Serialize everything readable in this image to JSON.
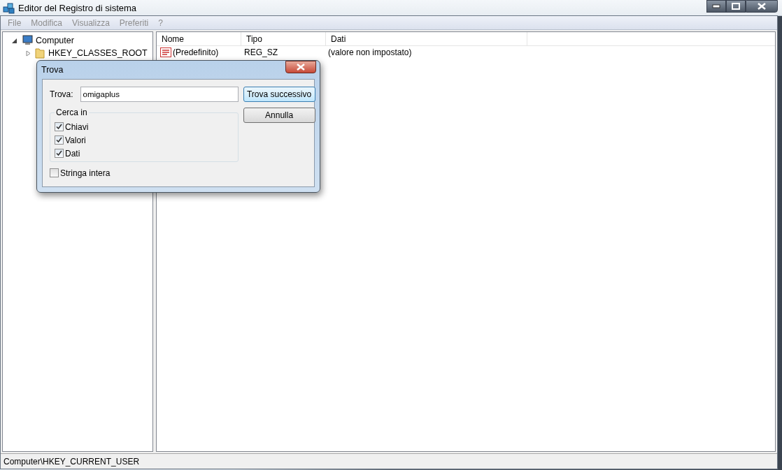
{
  "window": {
    "title": "Editor del Registro di sistema"
  },
  "menu": [
    {
      "label": "File",
      "disabled": true
    },
    {
      "label": "Modifica",
      "disabled": true
    },
    {
      "label": "Visualizza",
      "disabled": true
    },
    {
      "label": "Preferiti",
      "disabled": true
    },
    {
      "label": "?",
      "disabled": true
    }
  ],
  "tree": {
    "label": "Computer",
    "expanded": true,
    "children": [
      {
        "label": "HKEY_CLASSES_ROOT",
        "expanded": false
      }
    ]
  },
  "table": {
    "columns": [
      "Nome",
      "Tipo",
      "Dati"
    ],
    "rows": [
      {
        "name": "(Predefinito)",
        "type": "REG_SZ",
        "data": "(valore non impostato)"
      }
    ]
  },
  "status_bar": "Computer\\HKEY_CURRENT_USER",
  "dialog": {
    "title": "Trova",
    "find_label": "Trova:",
    "find_value": "omigaplus",
    "group_title": "Cerca in",
    "options": [
      {
        "label": "Chiavi",
        "checked": true
      },
      {
        "label": "Valori",
        "checked": true
      },
      {
        "label": "Dati",
        "checked": true
      }
    ],
    "whole_string": {
      "label": "Stringa intera",
      "checked": false
    },
    "buttons": [
      {
        "label": "Trova successivo",
        "default": true
      },
      {
        "label": "Annulla",
        "default": false
      }
    ]
  }
}
